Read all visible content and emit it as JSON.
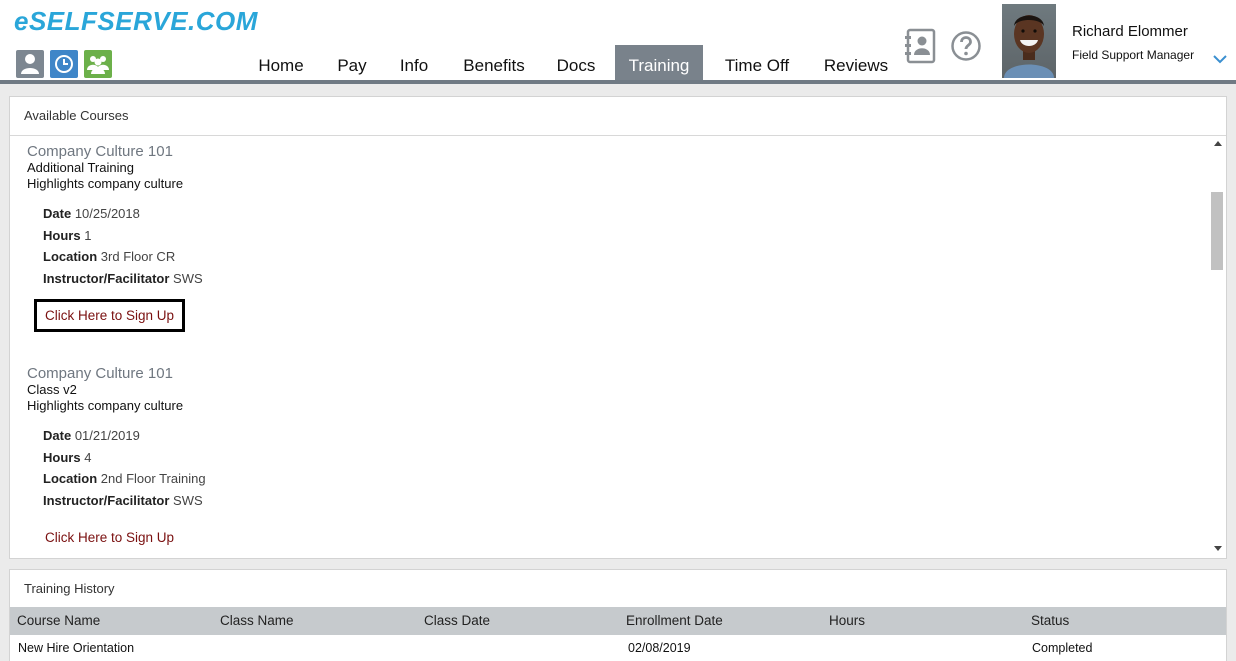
{
  "app": {
    "logo": "eSELFSERVE.COM"
  },
  "nav": {
    "items": [
      {
        "label": "Home"
      },
      {
        "label": "Pay"
      },
      {
        "label": "Info"
      },
      {
        "label": "Benefits"
      },
      {
        "label": "Docs"
      },
      {
        "label": "Training",
        "active": true
      },
      {
        "label": "Time Off"
      },
      {
        "label": "Reviews"
      }
    ]
  },
  "icons": {
    "mode_user": "user-icon",
    "mode_clock": "clock-icon",
    "mode_team": "team-icon",
    "contacts": "address-book-icon",
    "help": "help-icon",
    "menu": "chevron-down-icon"
  },
  "user": {
    "name": "Richard Elommer",
    "role": "Field Support Manager"
  },
  "colors": {
    "brand": "#2aa6d9",
    "active_tab": "#79828b",
    "signup_link": "#7a1010"
  },
  "available_courses": {
    "title": "Available Courses",
    "courses": [
      {
        "title": "Company Culture 101",
        "class": "Additional Training",
        "description": "Highlights company culture",
        "date_label": "Date",
        "date": "10/25/2018",
        "hours_label": "Hours",
        "hours": "1",
        "location_label": "Location",
        "location": "3rd Floor CR",
        "instructor_label": "Instructor/Facilitator",
        "instructor": "SWS",
        "signup": "Click Here to Sign Up"
      },
      {
        "title": "Company Culture 101",
        "class": "Class v2",
        "description": "Highlights company culture",
        "date_label": "Date",
        "date": "01/21/2019",
        "hours_label": "Hours",
        "hours": "4",
        "location_label": "Location",
        "location": "2nd Floor Training",
        "instructor_label": "Instructor/Facilitator",
        "instructor": "SWS",
        "signup": "Click Here to Sign Up"
      }
    ]
  },
  "training_history": {
    "title": "Training History",
    "columns": [
      "Course Name",
      "Class Name",
      "Class Date",
      "Enrollment Date",
      "Hours",
      "Status"
    ],
    "rows": [
      [
        "New Hire Orientation",
        "",
        "",
        "02/08/2019",
        "",
        "Completed"
      ]
    ]
  }
}
